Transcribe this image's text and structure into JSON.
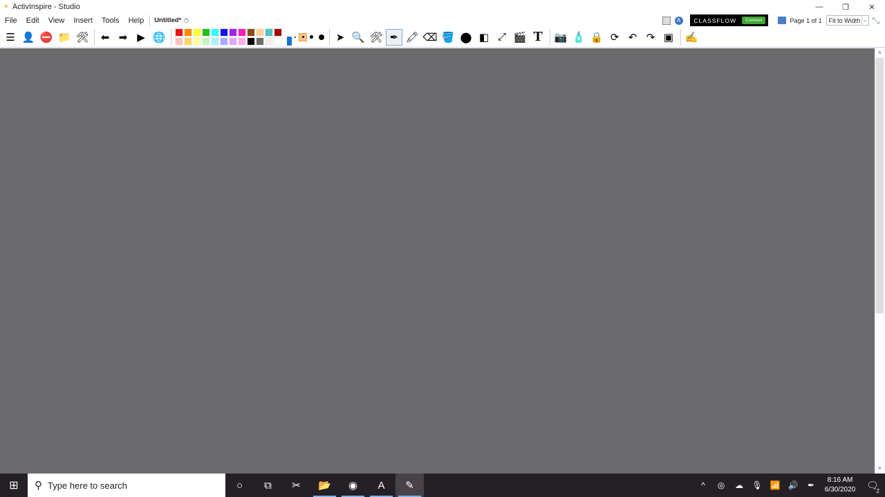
{
  "window": {
    "title": "ActivInspire - Studio",
    "controls": {
      "minimize": "—",
      "restore": "❐",
      "close": "✕"
    }
  },
  "menu": {
    "items": [
      "File",
      "Edit",
      "View",
      "Insert",
      "Tools",
      "Help"
    ],
    "doc_tab": "Untitled*",
    "doc_tab_close": "×"
  },
  "header_right": {
    "classflow_label": "CLASSFLOW",
    "connect_label": "Connect",
    "page_label": "Page 1 of 1",
    "zoom_value": "Fit to Width",
    "zoom_arrow": "⌄",
    "fullscreen_glyph": "⤡"
  },
  "toolbar": {
    "left_buttons": [
      {
        "name": "main-menu-icon",
        "glyph": "☰"
      },
      {
        "name": "browsers-icon",
        "glyph": "👤"
      },
      {
        "name": "no-entry-icon",
        "glyph": "⛔"
      },
      {
        "name": "resource-library-icon",
        "glyph": "📁"
      },
      {
        "name": "toolbox-settings-icon",
        "glyph": "🛠"
      },
      {
        "name": "previous-page-icon",
        "glyph": "⬅"
      },
      {
        "name": "next-page-icon",
        "glyph": "➡"
      },
      {
        "name": "play-icon",
        "glyph": "▶"
      },
      {
        "name": "activinspire-globe-icon",
        "glyph": "🌐"
      }
    ],
    "palette": {
      "row1": [
        "#e81313",
        "#ff8a00",
        "#ffff29",
        "#21c21a",
        "#33ffff",
        "#1414e6",
        "#a11ff0",
        "#ff1ab3",
        "#8a4a11",
        "#ffd19a",
        "#50c4c4",
        "#a10d0d"
      ],
      "row2": [
        "#ffc0c0",
        "#ffd766",
        "#ffff99",
        "#c4f5c0",
        "#a8f2ff",
        "#a8aaff",
        "#e0a6ff",
        "#ffacee",
        "#000000",
        "#6b6b6b",
        "#f0f0f0",
        "#ffffff"
      ]
    },
    "active_color": "#1a6fd8",
    "tool_buttons": [
      {
        "name": "select-icon",
        "glyph": "➤"
      },
      {
        "name": "magnifier-icon",
        "glyph": "🔍"
      },
      {
        "name": "tools-icon",
        "glyph": "🛠"
      },
      {
        "name": "pen-icon",
        "glyph": "✒",
        "active": true
      },
      {
        "name": "highlighter-icon",
        "glyph": "🖍"
      },
      {
        "name": "eraser-icon",
        "glyph": "⌫"
      },
      {
        "name": "fill-icon",
        "glyph": "🪣"
      },
      {
        "name": "shape-icon",
        "glyph": "⬤"
      },
      {
        "name": "magic-ink-icon",
        "glyph": "◧"
      },
      {
        "name": "connector-icon",
        "glyph": "⤢"
      },
      {
        "name": "clapperboard-icon",
        "glyph": "🎬"
      },
      {
        "name": "text-icon",
        "glyph": "T"
      },
      {
        "name": "camera-icon",
        "glyph": "📷"
      },
      {
        "name": "clear-icon",
        "glyph": "🧴"
      },
      {
        "name": "lock-icon",
        "glyph": "🔒"
      },
      {
        "name": "reset-page-icon",
        "glyph": "⟳"
      },
      {
        "name": "undo-icon",
        "glyph": "↶"
      },
      {
        "name": "redo-icon",
        "glyph": "↷"
      },
      {
        "name": "small-page-icon",
        "glyph": "▣"
      },
      {
        "name": "dual-user-icon",
        "glyph": "✍"
      }
    ]
  },
  "scrollbar": {
    "up": "˄",
    "down": "˅"
  },
  "taskbar": {
    "start_glyph": "⊞",
    "search_glyph": "⚲",
    "search_placeholder": "Type here to search",
    "apps": [
      {
        "name": "cortana-icon",
        "glyph": "○"
      },
      {
        "name": "task-view-icon",
        "glyph": "⧉"
      },
      {
        "name": "snipping-tool-icon",
        "glyph": "✂"
      },
      {
        "name": "file-explorer-icon",
        "glyph": "📂"
      },
      {
        "name": "chrome-icon",
        "glyph": "◉"
      },
      {
        "name": "acrobat-icon",
        "glyph": "A"
      },
      {
        "name": "activinspire-taskbar-icon",
        "glyph": "✎"
      }
    ],
    "tray": [
      {
        "name": "show-hidden-icons",
        "glyph": "^"
      },
      {
        "name": "app-tray-icon",
        "glyph": "◎"
      },
      {
        "name": "onedrive-icon",
        "glyph": "☁"
      },
      {
        "name": "microphone-icon",
        "glyph": "🎙"
      },
      {
        "name": "wifi-icon",
        "glyph": "📶"
      },
      {
        "name": "volume-icon",
        "glyph": "🔊"
      },
      {
        "name": "pen-workspace-icon",
        "glyph": "✒"
      }
    ],
    "time": "8:16 AM",
    "date": "6/30/2020",
    "notification_glyph": "🗨",
    "notification_count": "2"
  }
}
